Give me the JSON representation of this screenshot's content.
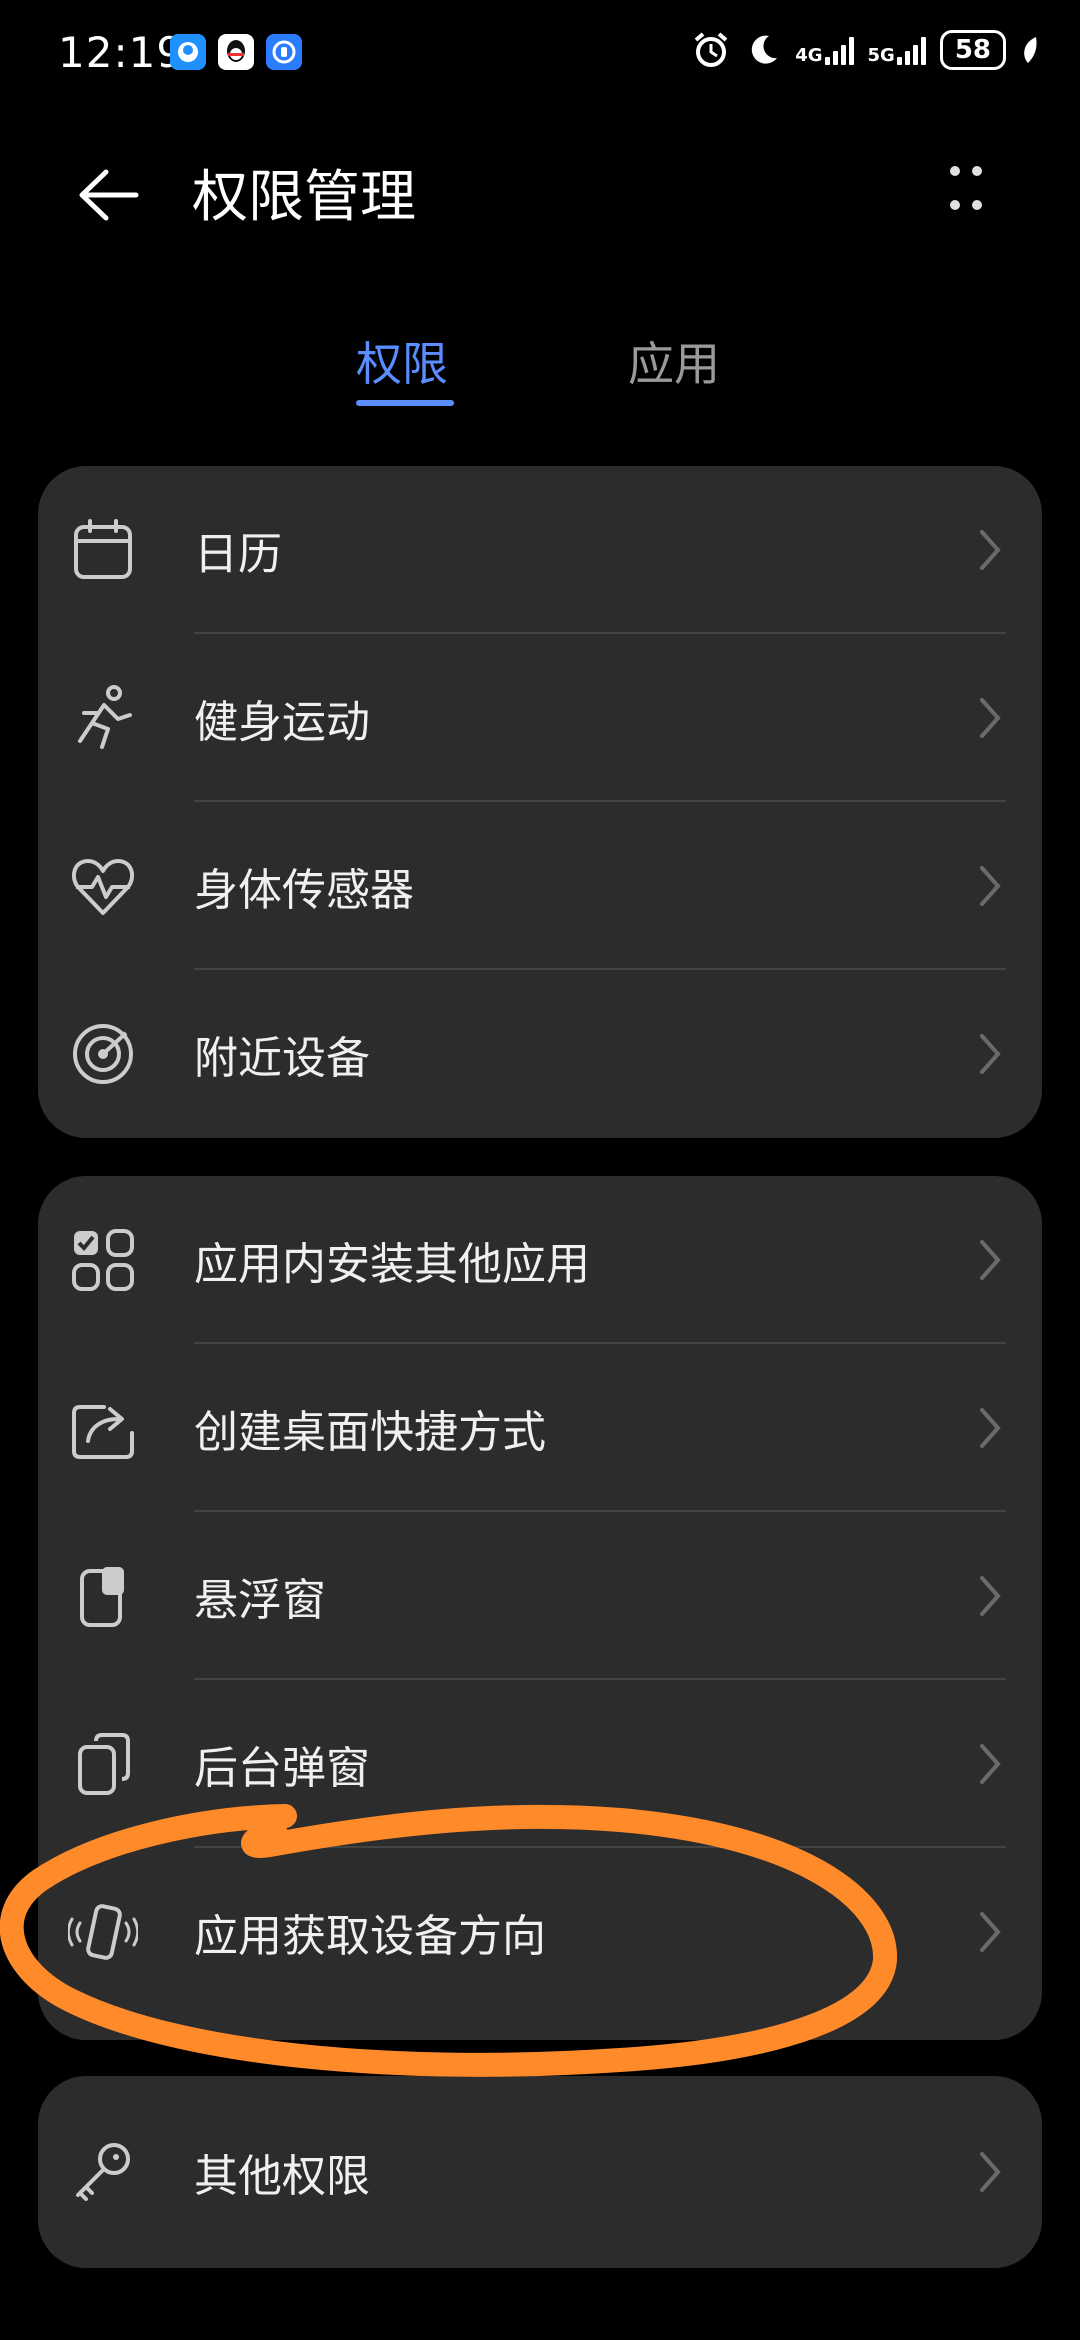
{
  "status_bar": {
    "time": "12:19",
    "net1": "4G",
    "net2": "5G",
    "battery": "58"
  },
  "header": {
    "title": "权限管理"
  },
  "tabs": [
    {
      "label": "权限"
    },
    {
      "label": "应用"
    }
  ],
  "groups": [
    {
      "items": [
        {
          "label": "日历",
          "icon": "calendar-icon"
        },
        {
          "label": "健身运动",
          "icon": "running-icon"
        },
        {
          "label": "身体传感器",
          "icon": "heart-pulse-icon"
        },
        {
          "label": "附近设备",
          "icon": "nearby-radar-icon"
        }
      ]
    },
    {
      "items": [
        {
          "label": "应用内安装其他应用",
          "icon": "install-apps-icon"
        },
        {
          "label": "创建桌面快捷方式",
          "icon": "shortcut-share-icon"
        },
        {
          "label": "悬浮窗",
          "icon": "floating-window-icon"
        },
        {
          "label": "后台弹窗",
          "icon": "background-popup-icon"
        },
        {
          "label": "应用获取设备方向",
          "icon": "device-orientation-icon"
        }
      ]
    },
    {
      "items": [
        {
          "label": "其他权限",
          "icon": "key-icon"
        }
      ]
    }
  ],
  "colors": {
    "accent": "#5a8dff",
    "card": "#2c2c2c",
    "annotation": "#ff8a2a"
  }
}
